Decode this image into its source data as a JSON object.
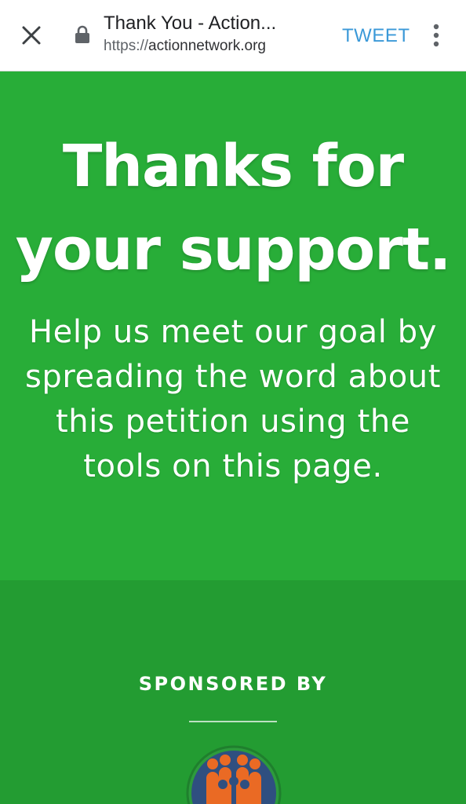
{
  "browser": {
    "page_title": "Thank You - Action...",
    "url_scheme": "https://",
    "url_host": "actionnetwork.org",
    "tweet_label": "TWEET",
    "icons": {
      "close": "close-icon",
      "lock": "lock-icon",
      "menu": "more-vert-icon"
    },
    "accent_color": "#3b99d8"
  },
  "hero": {
    "title_line1": "Thanks for",
    "title_line2": "your support.",
    "message": "Help us meet our goal by spreading the word about this petition using the tools on this page.",
    "background_color": "#28ad38"
  },
  "sponsor": {
    "label": "SPONSORED BY",
    "background_color": "#239c32",
    "logo_icon": "people-group-logo-icon"
  }
}
